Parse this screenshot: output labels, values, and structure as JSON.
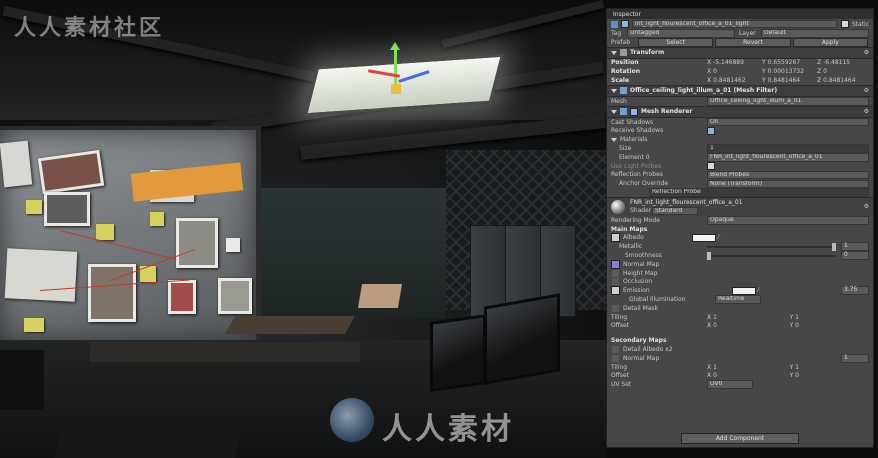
{
  "watermark": {
    "top_text": "人人素材社区",
    "bottom_text": "人人素材"
  },
  "inspector": {
    "tab_label": "Inspector",
    "gameobject": {
      "name": "int_light_flourescent_office_a_01_light",
      "static_label": "Static",
      "tag_label": "Tag",
      "tag_value": "Untagged",
      "layer_label": "Layer",
      "layer_value": "Default",
      "prefab_label": "Prefab",
      "prefab_buttons": [
        "Select",
        "Revert",
        "Apply"
      ]
    },
    "transform": {
      "title": "Transform",
      "position": {
        "label": "Position",
        "x": "-5.146889",
        "y": "0.6559267",
        "z": "-6.48115"
      },
      "rotation": {
        "label": "Rotation",
        "x": "0",
        "y": "0.00013732",
        "z": "0"
      },
      "scale": {
        "label": "Scale",
        "x": "0.8481462",
        "y": "0.8481464",
        "z": "0.8481464"
      }
    },
    "mesh_filter": {
      "title": "Office_ceiling_light_illum_a_01 (Mesh Filter)",
      "mesh_label": "Mesh",
      "mesh_value": "Office_ceiling_light_illum_a_01"
    },
    "mesh_renderer": {
      "title": "Mesh Renderer",
      "cast_shadows_label": "Cast Shadows",
      "cast_shadows_value": "On",
      "receive_shadows_label": "Receive Shadows",
      "materials_label": "Materials",
      "size_label": "Size",
      "size_value": "1",
      "element_label": "Element 0",
      "element_value": "FNR_int_light_flourescent_office_a_01",
      "light_probes_label": "Use Light Probes",
      "reflection_probes_label": "Reflection Probes",
      "reflection_probes_value": "Blend Probes",
      "anchor_label": "Anchor Override",
      "anchor_value": "None (Transform)",
      "probe_label": "Reflection Probe"
    },
    "material": {
      "name": "FNR_int_light_flourescent_office_a_01",
      "shader_label": "Shader",
      "shader_value": "Standard",
      "rendering_mode_label": "Rendering Mode",
      "rendering_mode_value": "Opaque",
      "main_maps_label": "Main Maps",
      "albedo_label": "Albedo",
      "metallic_label": "Metallic",
      "metallic_value": "1",
      "smoothness_label": "Smoothness",
      "smoothness_value": "0",
      "normal_label": "Normal Map",
      "height_label": "Height Map",
      "occlusion_label": "Occlusion",
      "emission_label": "Emission",
      "emission_value": "3.75",
      "gi_label": "Global Illumination",
      "gi_value": "Realtime",
      "detail_mask_label": "Detail Mask",
      "tiling_label": "Tiling",
      "offset_label": "Offset",
      "tiling_x": "1",
      "tiling_y": "1",
      "offset_x": "0",
      "offset_y": "0",
      "secondary_maps_label": "Secondary Maps",
      "detail_albedo_label": "Detail Albedo x2",
      "detail_normal_label": "Normal Map",
      "detail_normal_value": "1",
      "tiling2_x": "1",
      "tiling2_y": "1",
      "offset2_x": "0",
      "offset2_y": "0",
      "uv_set_label": "UV Set",
      "uv_set_value": "UV0"
    },
    "add_component": "Add Component"
  },
  "colors": {
    "inspector_bg": "#474747",
    "gizmo_x": "#e2403a",
    "gizmo_y": "#7ee15a",
    "gizmo_z": "#3f6fe0",
    "normal_map_swatch": "#8a7fd8"
  },
  "icons": [
    "gameobject-icon",
    "transform-icon",
    "mesh-filter-icon",
    "mesh-renderer-icon",
    "material-icon",
    "gear-icon",
    "eyedropper-icon"
  ]
}
